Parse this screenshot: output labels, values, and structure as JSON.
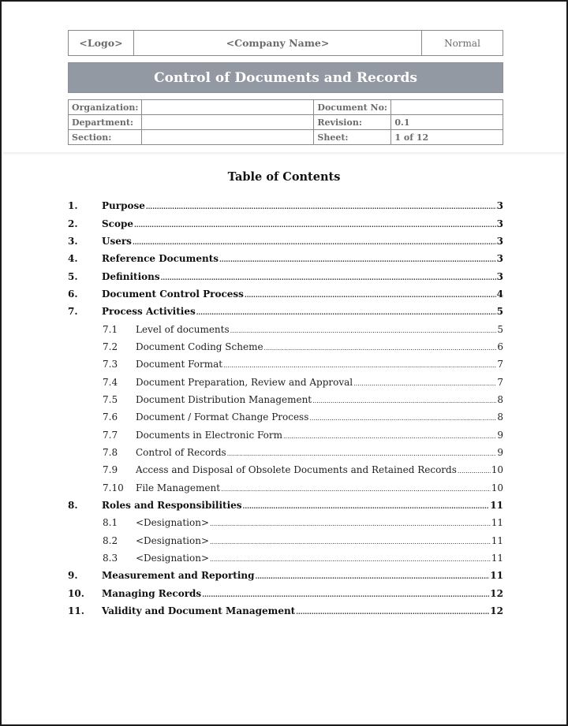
{
  "header": {
    "logo": "<Logo>",
    "company": "<Company Name>",
    "status": "Normal"
  },
  "title": "Control of Documents and Records",
  "meta": {
    "rows": [
      {
        "label1": "Organization:",
        "value1": "",
        "label2": "Document No:",
        "value2": ""
      },
      {
        "label1": "Department:",
        "value1": "",
        "label2": "Revision:",
        "value2": "0.1"
      },
      {
        "label1": "Section:",
        "value1": "",
        "label2": "Sheet:",
        "value2": "1 of 12"
      }
    ]
  },
  "toc": {
    "title": "Table of Contents",
    "entries": [
      {
        "num": "1.",
        "text": "Purpose",
        "page": "3",
        "level": 1
      },
      {
        "num": "2.",
        "text": "Scope",
        "page": "3",
        "level": 1
      },
      {
        "num": "3.",
        "text": "Users",
        "page": "3",
        "level": 1
      },
      {
        "num": "4.",
        "text": "Reference Documents",
        "page": "3",
        "level": 1
      },
      {
        "num": "5.",
        "text": "Definitions",
        "page": "3",
        "level": 1
      },
      {
        "num": "6.",
        "text": "Document Control Process",
        "page": "4",
        "level": 1
      },
      {
        "num": "7.",
        "text": "Process Activities",
        "page": "5",
        "level": 1
      },
      {
        "num": "7.1",
        "text": "Level of documents",
        "page": "5",
        "level": 2
      },
      {
        "num": "7.2",
        "text": "Document Coding Scheme",
        "page": "6",
        "level": 2
      },
      {
        "num": "7.3",
        "text": "Document Format",
        "page": "7",
        "level": 2
      },
      {
        "num": "7.4",
        "text": "Document Preparation, Review and Approval",
        "page": "7",
        "level": 2
      },
      {
        "num": "7.5",
        "text": "Document Distribution Management",
        "page": "8",
        "level": 2
      },
      {
        "num": "7.6",
        "text": "Document / Format Change Process",
        "page": "8",
        "level": 2
      },
      {
        "num": "7.7",
        "text": "Documents in Electronic Form",
        "page": "9",
        "level": 2
      },
      {
        "num": "7.8",
        "text": "Control of Records",
        "page": "9",
        "level": 2
      },
      {
        "num": "7.9",
        "text": "Access and Disposal of Obsolete Documents and Retained Records",
        "page": "10",
        "level": 2
      },
      {
        "num": "7.10",
        "text": "File Management",
        "page": "10",
        "level": 2
      },
      {
        "num": "8.",
        "text": "Roles and Responsibilities",
        "page": "11",
        "level": 1
      },
      {
        "num": "8.1",
        "text": "<Designation>",
        "page": "11",
        "level": 2
      },
      {
        "num": "8.2",
        "text": "<Designation>",
        "page": "11",
        "level": 2
      },
      {
        "num": "8.3",
        "text": "<Designation>",
        "page": "11",
        "level": 2
      },
      {
        "num": "9.",
        "text": "Measurement and Reporting",
        "page": "11",
        "level": 1
      },
      {
        "num": "10.",
        "text": "Managing Records",
        "page": "12",
        "level": 1
      },
      {
        "num": "11.",
        "text": "Validity and Document Management",
        "page": "12",
        "level": 1
      }
    ]
  }
}
